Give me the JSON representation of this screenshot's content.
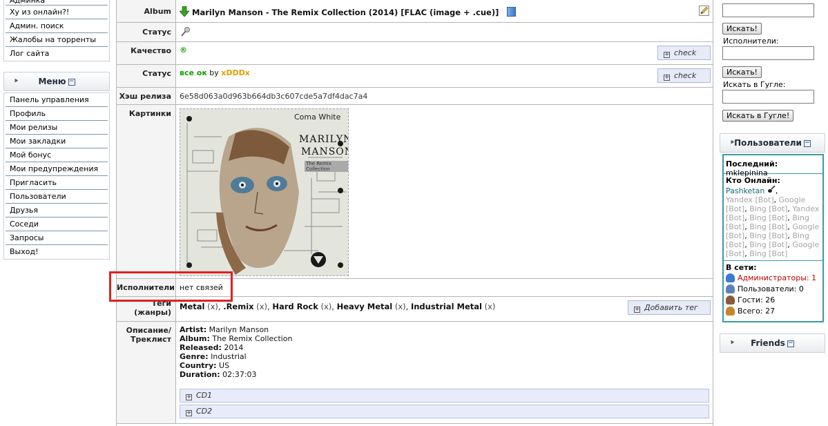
{
  "left_menu_top": {
    "items": [
      "Админка",
      "Ху из онлайн?!",
      "Админ. поиск",
      "Жалобы на торренты",
      "Лог сайта"
    ]
  },
  "menu": {
    "title": "Меню",
    "items": [
      "Панель управления",
      "Профиль",
      "Мои релизы",
      "Мои закладки",
      "Мой бонус",
      "Мои предупреждения",
      "Пригласить",
      "Пользователи",
      "Друзья",
      "Соседи",
      "Запросы",
      "Выход!"
    ]
  },
  "details": {
    "album_label": "Album",
    "album_title": "Marilyn Manson - The Remix Collection (2014) [FLAC (image + .cue)]",
    "status1_label": "Статус",
    "quality_label": "Качество",
    "quality_value": "®",
    "status2_label": "Статус",
    "status_ok": "все ок",
    "status_by": "by",
    "status_user": "xDDDx",
    "check_label": "check",
    "hash_label": "Хэш релиза",
    "hash_value": "6e58d063a0d963b664db3c607cde5a7df4dac7a4",
    "pictures_label": "Картинки",
    "performers_label": "Исполнители",
    "performers_value": "нет связей",
    "tags_label": "Теги (жанры)",
    "tags": [
      "Metal",
      ".Remix",
      "Hard Rock",
      "Heavy Metal",
      "Industrial Metal"
    ],
    "tag_remove": "(x)",
    "add_tag_label": "Добавить тег",
    "description_label": "Описание/ Треклист",
    "description": [
      {
        "key": "Artist:",
        "value": "Marilyn Manson"
      },
      {
        "key": "Album:",
        "value": "The Remix Collection"
      },
      {
        "key": "Released:",
        "value": "2014"
      },
      {
        "key": "Genre:",
        "value": "Industrial"
      },
      {
        "key": "Country:",
        "value": "US"
      },
      {
        "key": "Duration:",
        "value": "02:37:03"
      }
    ],
    "spoilers": [
      "CD1",
      "CD2"
    ]
  },
  "cover": {
    "heading": "Coma White",
    "band_line1": "MARILYN",
    "band_line2": "MANSON",
    "subtitle": "The Remix Collection"
  },
  "search": {
    "btn1": "Искать!",
    "performers_label": "Исполнители:",
    "btn2": "Искать!",
    "google_label": "Искать в Гугле:",
    "google_btn": "Искать в Гугле!"
  },
  "users_block": {
    "title": "Пользователи",
    "last_label": "Последний:",
    "last_user": "mklepinina",
    "who_online": "Кто Онлайн:",
    "online_user": "Pashketan",
    "bots": [
      "Yandex [Bot]",
      "Google [Bot]",
      "Bing [Bot]",
      "Yandex [Bot]",
      "Bing [Bot]",
      "Bing [Bot]",
      "Bing [Bot]",
      "Google [Bot]",
      "Bing [Bot]",
      "Bing [Bot]",
      "Bing [Bot]",
      "Google [Bot]",
      "Bing [Bot]"
    ],
    "network_label": "В сети:",
    "stats": [
      {
        "label": "Администраторы: 1",
        "color": "#c00000"
      },
      {
        "label": "Пользователи: 0",
        "color": "#222222"
      },
      {
        "label": "Гости: 26",
        "color": "#222222"
      },
      {
        "label": "Всего: 27",
        "color": "#222222"
      }
    ]
  },
  "friends": {
    "title": "Friends"
  },
  "colors": {
    "accent_green": "#14a000",
    "user_orange": "#e0a000",
    "highlight_red": "#e02020"
  }
}
